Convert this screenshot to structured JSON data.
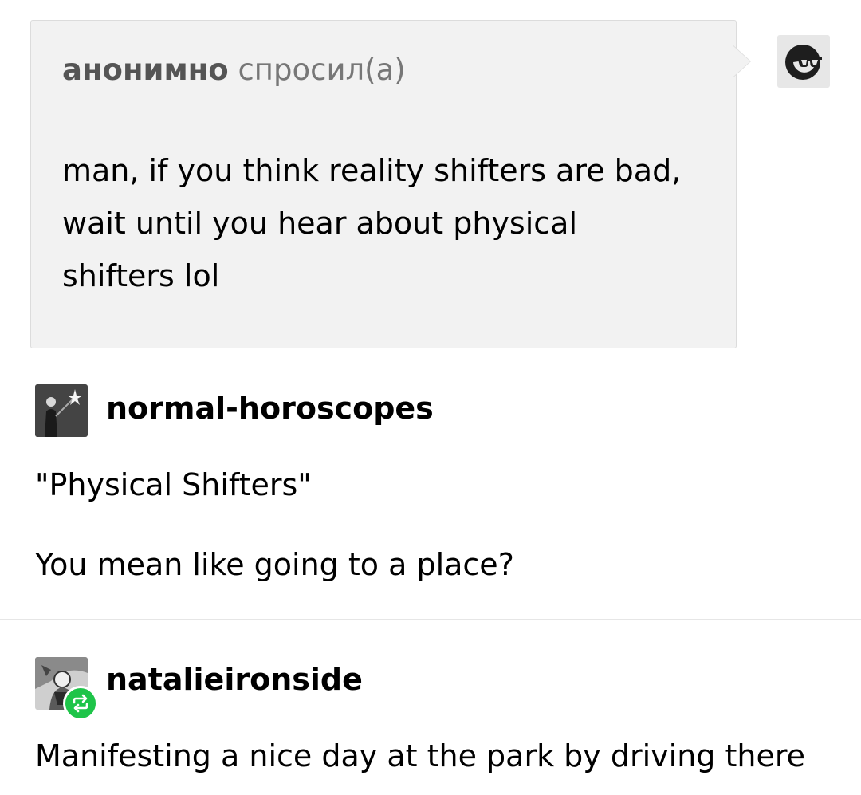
{
  "ask": {
    "asker": "анонимно",
    "verb": "спросил(а)",
    "text": "man, if you think reality shifters are bad, wait until you hear about physical shifters lol",
    "avatar_icon": "sunglasses-face-icon"
  },
  "posts": [
    {
      "username": "normal-horoscopes",
      "avatar_icon": "figure-with-sparkler-avatar",
      "paragraphs": [
        "\"Physical Shifters\"",
        "You mean like going to a place?"
      ]
    },
    {
      "username": "natalieironside",
      "avatar_icon": "engraving-portrait-avatar",
      "reblog_icon": "reblog-icon",
      "paragraphs": [
        "Manifesting a nice day at the park by driving there"
      ]
    }
  ],
  "colors": {
    "ask_bg": "#f2f2f2",
    "reblog_green": "#1ec449"
  }
}
